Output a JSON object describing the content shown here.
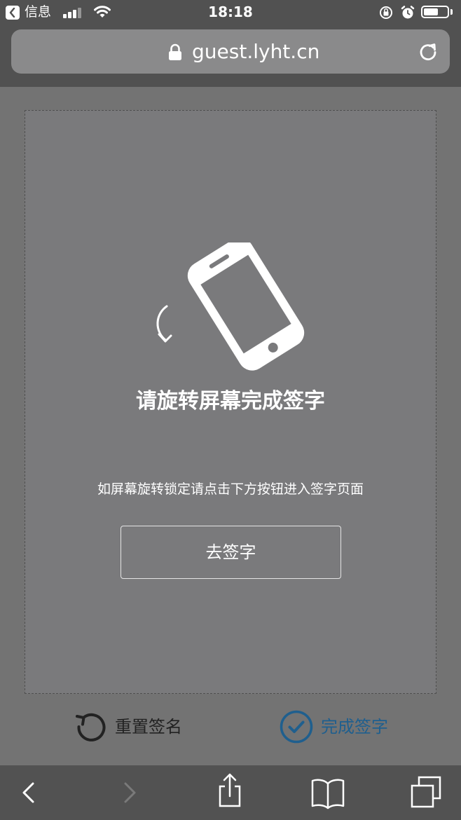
{
  "status_bar": {
    "app_name": "信息",
    "time": "18:18",
    "signal_bars": 4,
    "signal_active": 3,
    "battery_level": 0.62
  },
  "address_bar": {
    "url": "guest.lyht.cn"
  },
  "main": {
    "title": "请旋转屏幕完成签字",
    "hint": "如屏幕旋转锁定请点击下方按钮进入签字页面",
    "go_sign_label": "去签字"
  },
  "actions": {
    "reset_label": "重置签名",
    "done_label": "完成签字"
  },
  "colors": {
    "done_accent": "#1f5f8e",
    "reset_color": "#222222"
  },
  "icons": {
    "phone": "rotate-phone-icon",
    "reset": "undo-circle-icon",
    "done": "check-circle-icon",
    "back": "chevron-left-icon",
    "forward": "chevron-right-icon",
    "share": "share-icon",
    "bookmarks": "book-icon",
    "tabs": "tabs-icon"
  }
}
